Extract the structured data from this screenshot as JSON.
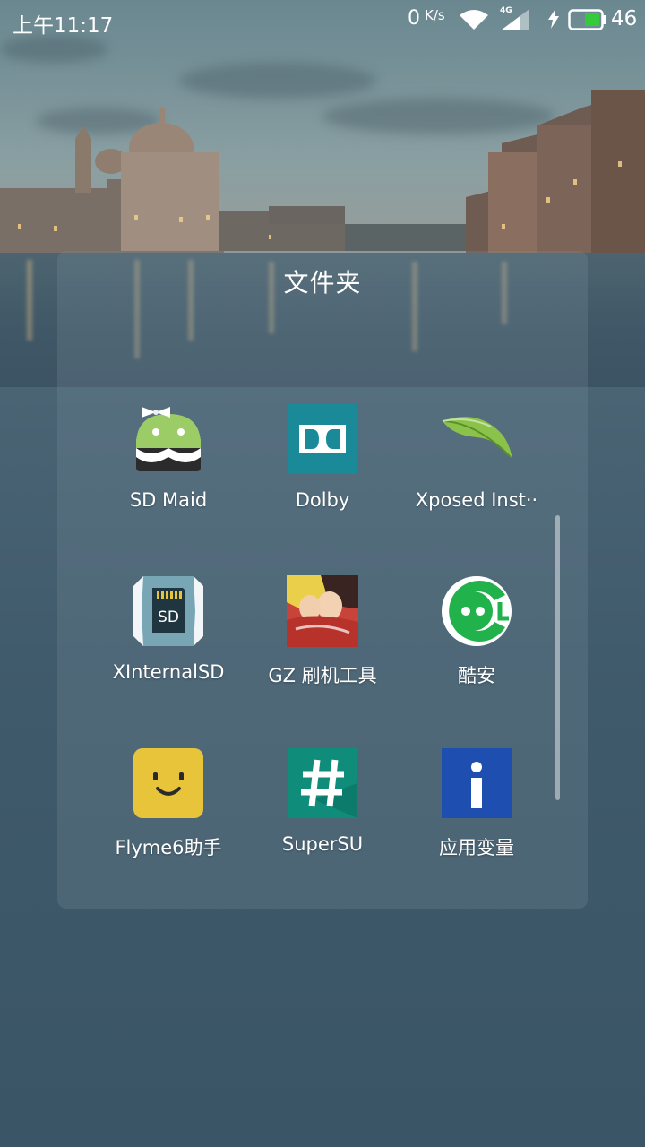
{
  "status_bar": {
    "time": "上午11:17",
    "net_speed": "0",
    "net_speed_unit": "K/s",
    "net_type": "4G",
    "battery": "46",
    "icons": [
      "wifi-icon",
      "signal-icon",
      "charging-icon",
      "battery-icon"
    ]
  },
  "folder": {
    "title": "文件夹",
    "apps": [
      {
        "label": "SD Maid",
        "icon": "sd-maid-icon"
      },
      {
        "label": "Dolby",
        "icon": "dolby-icon"
      },
      {
        "label": "Xposed Inst··",
        "icon": "xposed-leaf-icon"
      },
      {
        "label": "XInternalSD",
        "icon": "xinternalsd-icon"
      },
      {
        "label": "GZ 刷机工具",
        "icon": "gz-tool-icon"
      },
      {
        "label": "酷安",
        "icon": "coolapk-icon"
      },
      {
        "label": "Flyme6助手",
        "icon": "flyme-assistant-icon"
      },
      {
        "label": "SuperSU",
        "icon": "supersu-icon"
      },
      {
        "label": "应用变量",
        "icon": "app-variable-icon"
      }
    ]
  },
  "colors": {
    "dolby": "#1a8a99",
    "supersu": "#0f8c7a",
    "app_variable": "#1e4fb0",
    "flyme": "#e8c43a",
    "coolapk": "#22b24c",
    "battery": "#35c93c"
  }
}
